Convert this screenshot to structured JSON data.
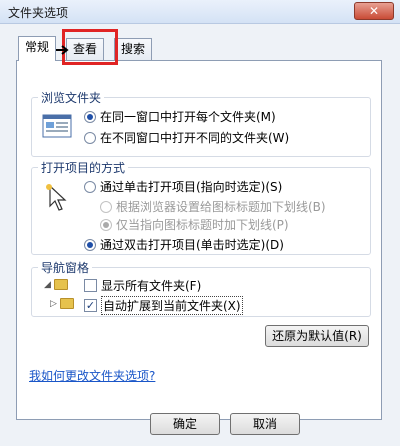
{
  "window": {
    "title": "文件夹选项",
    "close_glyph": "✕"
  },
  "tabs": [
    {
      "label": "常规"
    },
    {
      "label": "查看"
    },
    {
      "label": "搜索"
    }
  ],
  "browse_group": {
    "title": "浏览文件夹",
    "options": [
      {
        "label": "在同一窗口中打开每个文件夹(M)",
        "checked": true
      },
      {
        "label": "在不同窗口中打开不同的文件夹(W)",
        "checked": false
      }
    ]
  },
  "open_group": {
    "title": "打开项目的方式",
    "options": [
      {
        "label": "通过单击打开项目(指向时选定)(S)",
        "checked": false
      },
      {
        "label": "根据浏览器设置给图标标题加下划线(B)",
        "checked": false,
        "disabled": true
      },
      {
        "label": "仅当指向图标标题时加下划线(P)",
        "checked": true,
        "disabled": true
      },
      {
        "label": "通过双击打开项目(单击时选定)(D)",
        "checked": true
      }
    ]
  },
  "nav_group": {
    "title": "导航窗格",
    "options": [
      {
        "label": "显示所有文件夹(F)",
        "checked": false
      },
      {
        "label": "自动扩展到当前文件夹(X)",
        "checked": true
      }
    ]
  },
  "restore_button": "还原为默认值(R)",
  "help_link": "我如何更改文件夹选项?",
  "footer": {
    "ok": "确定",
    "cancel": "取消"
  }
}
